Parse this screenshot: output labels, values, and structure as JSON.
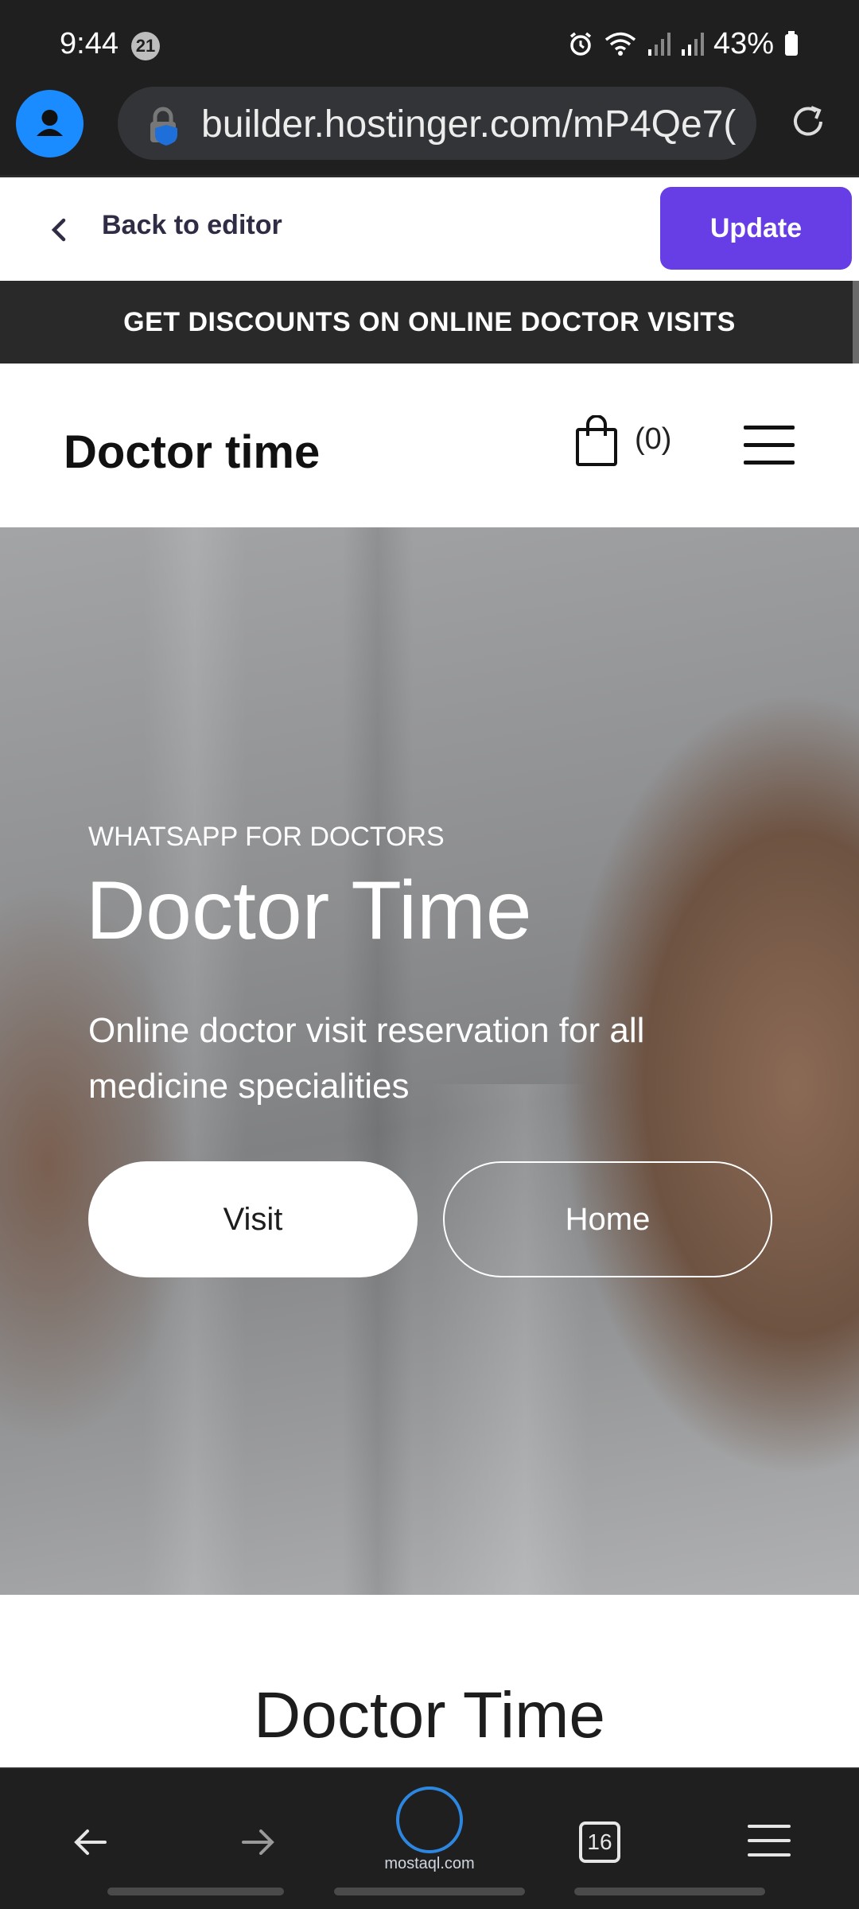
{
  "status_bar": {
    "time": "9:44",
    "notification_count": "21",
    "battery": "43%"
  },
  "browser": {
    "url": "builder.hostinger.com/mP4Qe7("
  },
  "editor_bar": {
    "back_label": "Back to editor",
    "update_label": "Update",
    "accent_color": "#673de6"
  },
  "announcement": {
    "text": "GET DISCOUNTS ON ONLINE DOCTOR VISITS"
  },
  "site_header": {
    "logo_text": "Doctor time",
    "cart_count": "(0)"
  },
  "hero": {
    "eyebrow": "WHATSAPP FOR DOCTORS",
    "title": "Doctor Time",
    "subtitle": "Online doctor visit reservation for all medicine specialities",
    "primary_button": "Visit",
    "secondary_button": "Home"
  },
  "section": {
    "title": "Doctor Time"
  },
  "bottom_nav": {
    "tab_count": "16",
    "watermark_text": "mostaql.com"
  }
}
